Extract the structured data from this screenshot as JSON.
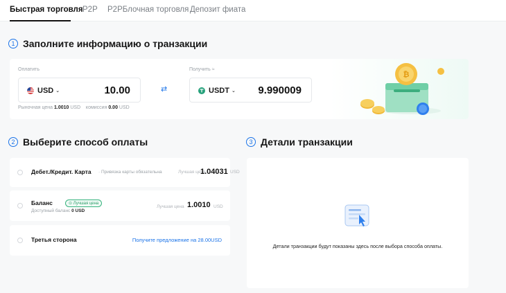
{
  "tabs": [
    {
      "label": "Быстрая торговля",
      "active": true
    },
    {
      "label": "P2P",
      "active": false
    },
    {
      "label": "P2PБлочная торговля",
      "active": false
    },
    {
      "label": "Депозит фиата",
      "active": false
    }
  ],
  "step1": {
    "num": "1",
    "title": "Заполните информацию о транзакции"
  },
  "pay": {
    "label": "Оплатить",
    "currency": "USD",
    "amount": "10.00",
    "market_label": "Рыночная цена",
    "market_value": "1.0010",
    "market_unit": "USD",
    "fee_label": "комиссия",
    "fee_value": "0.00",
    "fee_unit": "USD"
  },
  "receive": {
    "label": "Получить ≈",
    "currency": "USDT",
    "amount": "9.990009"
  },
  "step2": {
    "num": "2",
    "title": "Выберите способ оплаты"
  },
  "step3": {
    "num": "3",
    "title": "Детали транзакции"
  },
  "methods": {
    "card": {
      "title": "Дебет./Кредит. Карта",
      "note": "Привязка карты обязательна",
      "price_label": "Лучшая цена",
      "price": "1.04031",
      "unit": "USD"
    },
    "balance": {
      "title": "Баланс",
      "badge": "Лучшая цена",
      "sub_label": "Доступный баланс",
      "sub_value": "0 USD",
      "price_label": "Лучшая цена",
      "price": "1.0010",
      "unit": "USD"
    },
    "third": {
      "title": "Третья сторона",
      "link": "Получите предложение на 28.00USD"
    }
  },
  "details": {
    "placeholder": "Детали транзакции будут показаны здесь после выбора способа оплаты."
  },
  "colors": {
    "accent": "#1a73e8",
    "success": "#2e9e6b",
    "usdt": "#26a17b"
  },
  "icons": [
    "us-flag-icon",
    "chevron-down-icon",
    "usdt-icon",
    "swap-arrows-icon",
    "transaction-details-icon",
    "coins-illustration",
    "check-badge-icon"
  ]
}
